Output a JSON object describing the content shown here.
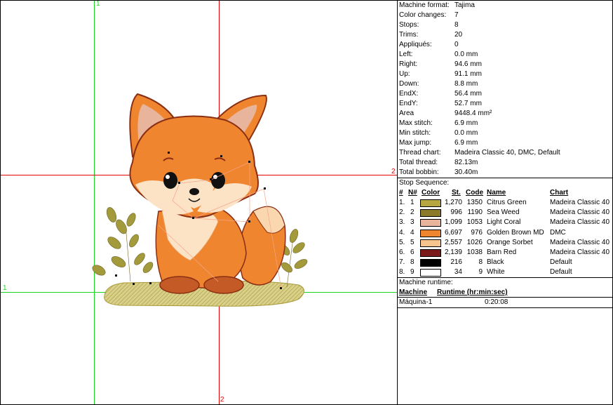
{
  "guides": {
    "green_v_label": "1",
    "green_h_label": "1",
    "red_v_label": "2",
    "red_h_label": "2"
  },
  "info": [
    {
      "label": "Machine format:",
      "value": "Tajima"
    },
    {
      "label": "Color changes:",
      "value": "7"
    },
    {
      "label": "Stops:",
      "value": "8"
    },
    {
      "label": "Trims:",
      "value": "20"
    },
    {
      "label": "Appliqués:",
      "value": "0"
    },
    {
      "label": "Left:",
      "value": "0.0 mm"
    },
    {
      "label": "Right:",
      "value": "94.6 mm"
    },
    {
      "label": "Up:",
      "value": "91.1 mm"
    },
    {
      "label": "Down:",
      "value": "8.8 mm"
    },
    {
      "label": "EndX:",
      "value": "56.4 mm"
    },
    {
      "label": "EndY:",
      "value": "52.7 mm"
    },
    {
      "label": "Area",
      "value": "9448.4 mm²"
    },
    {
      "label": "Max stitch:",
      "value": "6.9 mm"
    },
    {
      "label": "Min stitch:",
      "value": "0.0 mm"
    },
    {
      "label": "Max jump:",
      "value": "6.9 mm"
    },
    {
      "label": "Thread chart:",
      "value": "Madeira Classic 40, DMC, Default"
    },
    {
      "label": "Total thread:",
      "value": "82.13m"
    },
    {
      "label": "Total bobbin:",
      "value": "30.40m"
    }
  ],
  "stop_sequence": {
    "title": "Stop Sequence:",
    "headers": {
      "num": "#",
      "n": "N#",
      "color": "Color",
      "st": "St.",
      "code": "Code",
      "name": "Name",
      "chart": "Chart"
    },
    "rows": [
      {
        "num": "1.",
        "n": "1",
        "color": "#b5a642",
        "st": "1,270",
        "code": "1350",
        "name": "Citrus Green",
        "chart": "Madeira Classic 40"
      },
      {
        "num": "2.",
        "n": "2",
        "color": "#8c7a2b",
        "st": "996",
        "code": "1190",
        "name": "Sea Weed",
        "chart": "Madeira Classic 40"
      },
      {
        "num": "3.",
        "n": "3",
        "color": "#e8b49c",
        "st": "1,099",
        "code": "1053",
        "name": "Light Coral",
        "chart": "Madeira Classic 40"
      },
      {
        "num": "4.",
        "n": "4",
        "color": "#f0852f",
        "st": "6,697",
        "code": "976",
        "name": "Golden Brown MD",
        "chart": "DMC"
      },
      {
        "num": "5.",
        "n": "5",
        "color": "#f7c48e",
        "st": "2,557",
        "code": "1026",
        "name": "Orange Sorbet",
        "chart": "Madeira Classic 40"
      },
      {
        "num": "6.",
        "n": "6",
        "color": "#7b1a1a",
        "st": "2,139",
        "code": "1038",
        "name": "Barn Red",
        "chart": "Madeira Classic 40"
      },
      {
        "num": "7.",
        "n": "8",
        "color": "#000000",
        "st": "216",
        "code": "8",
        "name": "Black",
        "chart": "Default"
      },
      {
        "num": "8.",
        "n": "9",
        "color": "#ffffff",
        "st": "34",
        "code": "9",
        "name": "White",
        "chart": "Default"
      }
    ]
  },
  "runtime": {
    "title": "Machine runtime:",
    "headers": {
      "machine": "Machine",
      "runtime": "Runtime (hr:min:sec)"
    },
    "rows": [
      {
        "machine": "Máquina-1",
        "runtime": "0:20:08"
      }
    ]
  },
  "colors": {
    "guide_green": "#1bd41b",
    "guide_red": "#e30000"
  }
}
